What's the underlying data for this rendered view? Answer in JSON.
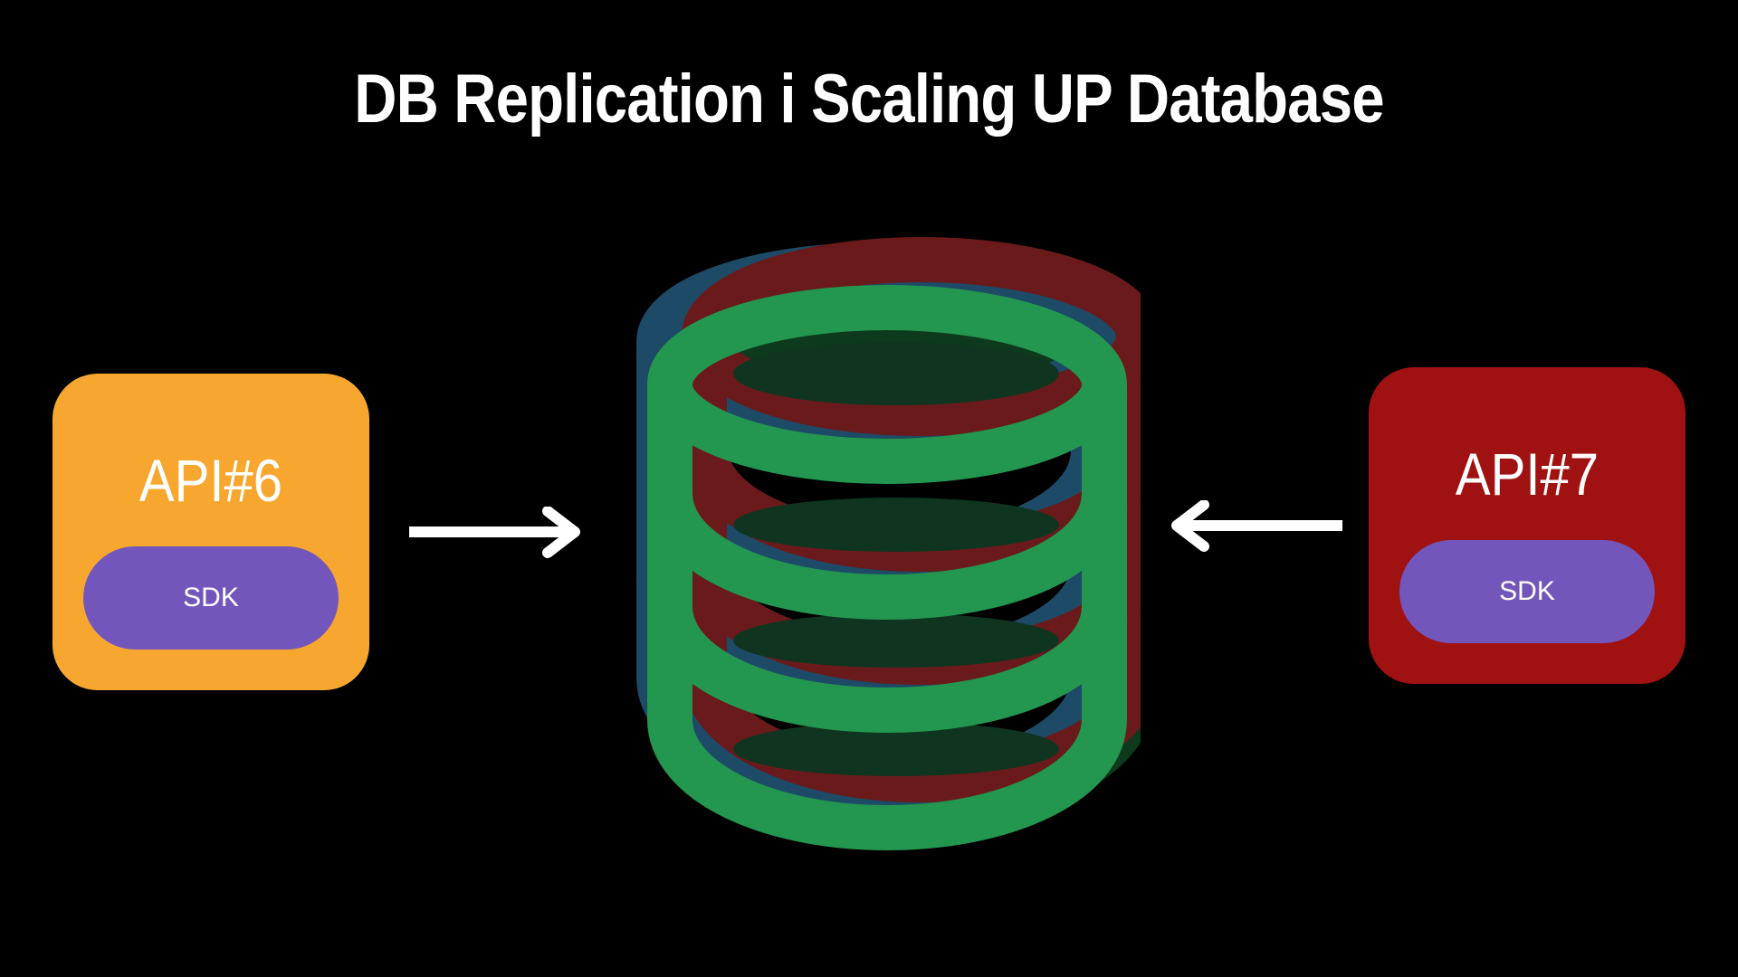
{
  "title": "DB Replication i Scaling UP Database",
  "left_api": {
    "label": "API#6",
    "sdk_label": "SDK",
    "color": "#f7a72f"
  },
  "right_api": {
    "label": "API#7",
    "sdk_label": "SDK",
    "color": "#a01212"
  },
  "sdk_color": "#7356bb",
  "database": {
    "icon": "database-icon",
    "layers": [
      {
        "name": "back-layer",
        "color": "#1d4a66"
      },
      {
        "name": "middle-layer",
        "color": "#6a1a1a"
      },
      {
        "name": "front-layer",
        "color": "#23964f"
      }
    ]
  },
  "arrows": [
    {
      "name": "arrow-right-icon",
      "direction": "right"
    },
    {
      "name": "arrow-left-icon",
      "direction": "left"
    }
  ]
}
